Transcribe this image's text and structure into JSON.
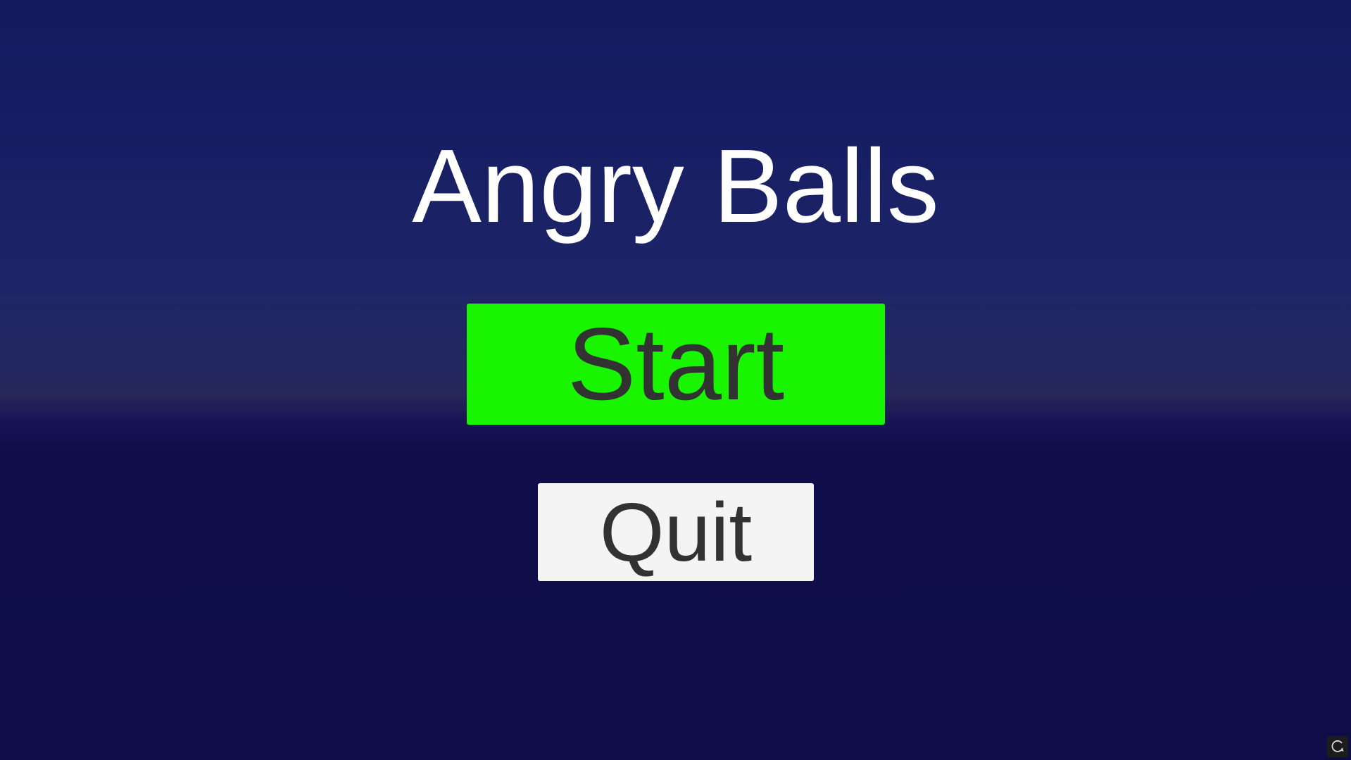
{
  "game": {
    "title": "Angry Balls"
  },
  "menu": {
    "start_label": "Start",
    "quit_label": "Quit"
  },
  "colors": {
    "start_button": "#19f500",
    "quit_button": "#f4f4f4",
    "button_text": "#323232",
    "title_text": "#ffffff",
    "background": "#0f0e4a"
  },
  "icons": {
    "corner": "refresh-icon"
  }
}
